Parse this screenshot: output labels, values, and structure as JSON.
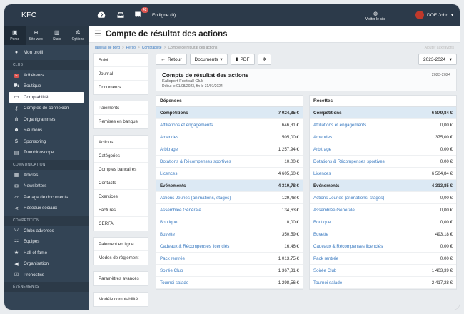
{
  "app": {
    "brand": "KFC",
    "notification_count": "42",
    "online_status": "En ligne (0)",
    "visit_site": "Visiter le site",
    "user_name": "DOE John"
  },
  "sidebar": {
    "tabs": [
      {
        "label": "Perso",
        "icon": "id-card-icon"
      },
      {
        "label": "Site web",
        "icon": "globe-icon"
      },
      {
        "label": "Stats",
        "icon": "chart-icon"
      },
      {
        "label": "Options",
        "icon": "gear-icon"
      }
    ],
    "profile": "Mon profil",
    "club_title": "CLUB",
    "club_items": [
      {
        "label": "Adhérents",
        "icon": "members-icon"
      },
      {
        "label": "Boutique",
        "icon": "cart-icon"
      },
      {
        "label": "Comptabilité",
        "icon": "money-icon"
      },
      {
        "label": "Comptes de connexion",
        "icon": "key-icon"
      },
      {
        "label": "Organigrammes",
        "icon": "sitemap-icon"
      },
      {
        "label": "Réunions",
        "icon": "meeting-icon"
      },
      {
        "label": "Sponsoring",
        "icon": "dollar-icon"
      },
      {
        "label": "Trombinoscope",
        "icon": "photo-icon"
      }
    ],
    "comm_title": "COMMUNICATION",
    "comm_items": [
      {
        "label": "Articles",
        "icon": "article-icon"
      },
      {
        "label": "Newsletters",
        "icon": "newsletter-icon"
      },
      {
        "label": "Partage de documents",
        "icon": "share-icon"
      },
      {
        "label": "Réseaux sociaux",
        "icon": "social-icon"
      }
    ],
    "comp_title": "COMPÉTITION",
    "comp_items": [
      {
        "label": "Clubs adverses",
        "icon": "shield-icon"
      },
      {
        "label": "Equipes",
        "icon": "team-icon"
      },
      {
        "label": "Hall of fame",
        "icon": "star-icon"
      },
      {
        "label": "Organisation",
        "icon": "megaphone-icon"
      },
      {
        "label": "Pronostics",
        "icon": "check-icon"
      }
    ],
    "events_title": "ÉVÉNEMENTS"
  },
  "page": {
    "title": "Compte de résultat des actions",
    "breadcrumb": [
      "Tableau de bord",
      "Perso",
      "Comptabilité",
      "Compte de résultat des actions"
    ],
    "breadcrumb_right": "Ajouter aux favoris"
  },
  "submenu": {
    "group1": [
      "Suivi",
      "Journal",
      "Documents"
    ],
    "group2": [
      "Paiements",
      "Remises en banque"
    ],
    "group3": [
      "Actions",
      "Catégories",
      "Comptes bancaires",
      "Contacts",
      "Exercices",
      "Factures",
      "CERFA"
    ],
    "group4": [
      "Paiement en ligne",
      "Modes de règlement"
    ],
    "group5": [
      "Paramètres avancés"
    ],
    "group6": [
      "Modèle comptabilité"
    ]
  },
  "toolbar": {
    "back": "Retour",
    "documents": "Documents",
    "pdf": "PDF",
    "year": "2023-2024"
  },
  "summary": {
    "title": "Compte de résultat des actions",
    "club": "Kalisport Football Club",
    "period": "Début le 01/08/2023, fin le 31/07/2024",
    "year": "2023-2024"
  },
  "depenses": {
    "title": "Dépenses",
    "rows": [
      {
        "label": "Compétitions",
        "value": "7 024,85 €",
        "category": true
      },
      {
        "label": "Affiliations et engagements",
        "value": "646,31 €"
      },
      {
        "label": "Amendes",
        "value": "505,00 €"
      },
      {
        "label": "Arbitrage",
        "value": "1 257,94 €"
      },
      {
        "label": "Dotations & Récompenses sportives",
        "value": "10,00 €"
      },
      {
        "label": "Licences",
        "value": "4 605,60 €"
      },
      {
        "label": "Evénements",
        "value": "4 310,78 €",
        "category": true
      },
      {
        "label": "Actions Jeunes (animations, stages)",
        "value": "129,48 €"
      },
      {
        "label": "Assemblée Générale",
        "value": "134,63 €"
      },
      {
        "label": "Boutique",
        "value": "0,00 €"
      },
      {
        "label": "Buvette",
        "value": "350,59 €"
      },
      {
        "label": "Cadeaux & Récompenses licenciés",
        "value": "16,46 €"
      },
      {
        "label": "Pack rentrée",
        "value": "1 013,75 €"
      },
      {
        "label": "Soirée Club",
        "value": "1 367,31 €"
      },
      {
        "label": "Tournoi salade",
        "value": "1 298,56 €"
      }
    ]
  },
  "recettes": {
    "title": "Recettes",
    "rows": [
      {
        "label": "Compétitions",
        "value": "6 879,84 €",
        "category": true
      },
      {
        "label": "Affiliations et engagements",
        "value": "0,00 €"
      },
      {
        "label": "Amendes",
        "value": "375,00 €"
      },
      {
        "label": "Arbitrage",
        "value": "0,00 €"
      },
      {
        "label": "Dotations & Récompenses sportives",
        "value": "0,00 €"
      },
      {
        "label": "Licences",
        "value": "6 504,84 €"
      },
      {
        "label": "Evénements",
        "value": "4 313,85 €",
        "category": true
      },
      {
        "label": "Actions Jeunes (animations, stages)",
        "value": "0,00 €"
      },
      {
        "label": "Assemblée Générale",
        "value": "0,00 €"
      },
      {
        "label": "Boutique",
        "value": "0,00 €"
      },
      {
        "label": "Buvette",
        "value": "493,18 €"
      },
      {
        "label": "Cadeaux & Récompenses licenciés",
        "value": "0,00 €"
      },
      {
        "label": "Pack rentrée",
        "value": "0,00 €"
      },
      {
        "label": "Soirée Club",
        "value": "1 403,39 €"
      },
      {
        "label": "Tournoi salade",
        "value": "2 417,28 €"
      }
    ]
  }
}
